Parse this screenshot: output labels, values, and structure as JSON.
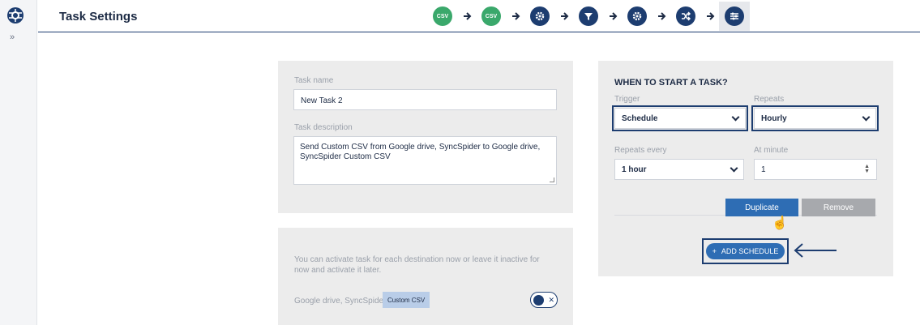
{
  "header": {
    "title": "Task Settings",
    "steps": [
      {
        "label": "CSV",
        "icon": "csv-icon"
      },
      {
        "label": "CSV",
        "icon": "csv-icon"
      },
      {
        "icon": "gear-icon"
      },
      {
        "icon": "filter-icon"
      },
      {
        "icon": "gear-icon"
      },
      {
        "icon": "shuffle-icon"
      },
      {
        "icon": "sliders-icon"
      }
    ]
  },
  "sidebar": {
    "expand_label": "»"
  },
  "task": {
    "name_label": "Task name",
    "name_value": "New Task 2",
    "description_label": "Task description",
    "description_value": "Send Custom CSV from Google drive, SyncSpider to Google drive, SyncSpider Custom CSV"
  },
  "schedule": {
    "title": "WHEN TO START A TASK?",
    "trigger_label": "Trigger",
    "trigger_value": "Schedule",
    "repeats_label": "Repeats",
    "repeats_value": "Hourly",
    "repeats_every_label": "Repeats every",
    "repeats_every_value": "1 hour",
    "at_minute_label": "At minute",
    "at_minute_value": "1",
    "duplicate_label": "Duplicate",
    "remove_label": "Remove",
    "add_schedule_label": "ADD SCHEDULE"
  },
  "activate": {
    "info": "You can activate task for each destination now or leave it inactive for now and activate it later.",
    "destination_label": "Google drive, SyncSpider",
    "destination_tag": "Custom CSV"
  },
  "colors": {
    "primary": "#1d3d70",
    "button_blue": "#2e6db4",
    "step_green": "#3aa86b",
    "panel_bg": "#ececec"
  }
}
